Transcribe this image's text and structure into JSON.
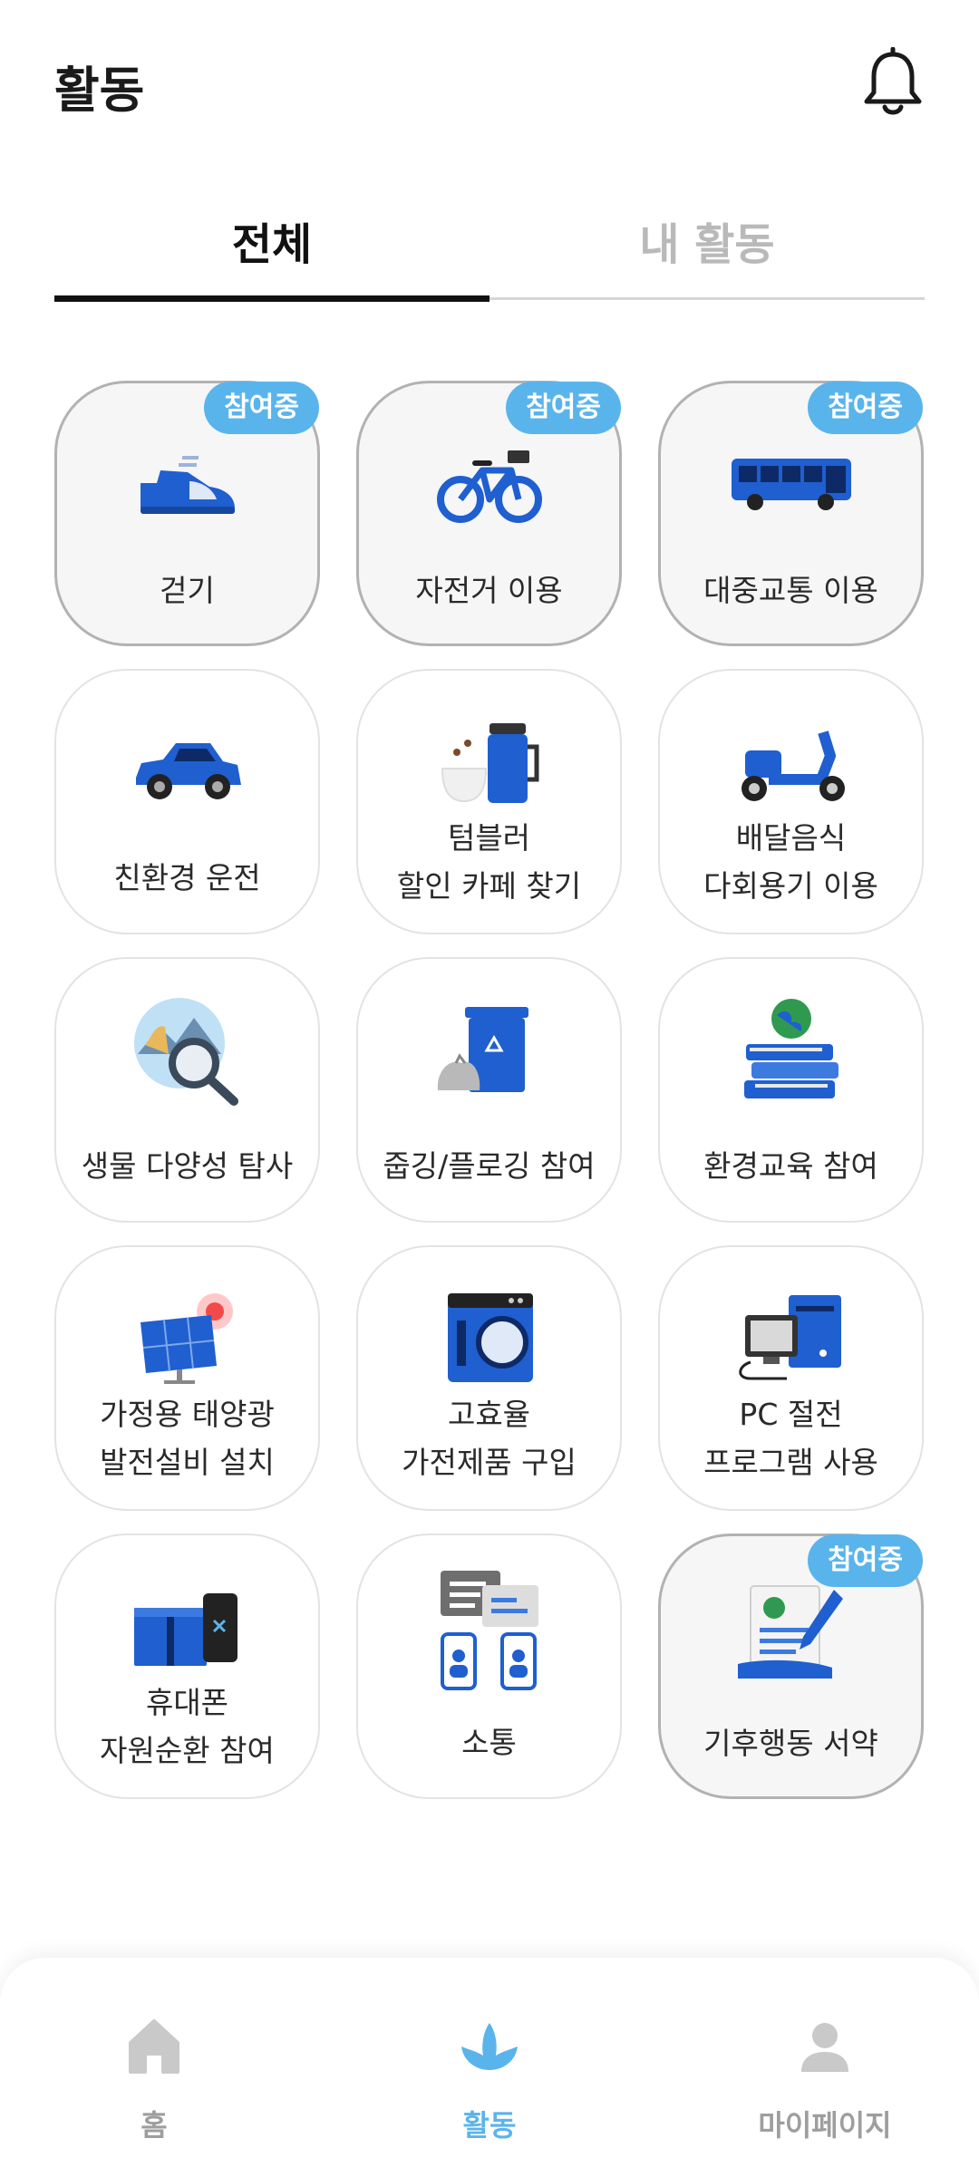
{
  "header": {
    "title": "활동",
    "notification_icon": "bell-icon"
  },
  "tabs": [
    {
      "label": "전체",
      "selected": true
    },
    {
      "label": "내 활동",
      "selected": false
    }
  ],
  "badge_text": "참여중",
  "activities": [
    {
      "line1": "걷기",
      "line2": "",
      "participating": true,
      "icon": "sneaker-icon"
    },
    {
      "line1": "자전거 이용",
      "line2": "",
      "participating": true,
      "icon": "bicycle-icon"
    },
    {
      "line1": "대중교통 이용",
      "line2": "",
      "participating": true,
      "icon": "bus-icon"
    },
    {
      "line1": "친환경 운전",
      "line2": "",
      "participating": false,
      "icon": "car-icon"
    },
    {
      "line1": "텀블러",
      "line2": "할인 카페 찾기",
      "participating": false,
      "icon": "tumbler-icon"
    },
    {
      "line1": "배달음식",
      "line2": "다회용기 이용",
      "participating": false,
      "icon": "scooter-icon"
    },
    {
      "line1": "생물 다양성 탐사",
      "line2": "",
      "participating": false,
      "icon": "magnifier-globe-icon"
    },
    {
      "line1": "줍깅/플로깅 참여",
      "line2": "",
      "participating": false,
      "icon": "recycle-bin-icon"
    },
    {
      "line1": "환경교육 참여",
      "line2": "",
      "participating": false,
      "icon": "books-globe-icon"
    },
    {
      "line1": "가정용 태양광",
      "line2": "발전설비 설치",
      "participating": false,
      "icon": "solar-panel-icon"
    },
    {
      "line1": "고효율",
      "line2": "가전제품 구입",
      "participating": false,
      "icon": "washing-machine-icon"
    },
    {
      "line1": "PC 절전",
      "line2": "프로그램 사용",
      "participating": false,
      "icon": "computer-icon"
    },
    {
      "line1": "휴대폰",
      "line2": "자원순환 참여",
      "participating": false,
      "icon": "phone-box-icon"
    },
    {
      "line1": "소통",
      "line2": "",
      "participating": false,
      "icon": "chat-people-icon"
    },
    {
      "line1": "기후행동 서약",
      "line2": "",
      "participating": true,
      "icon": "pledge-document-icon"
    }
  ],
  "bottom_nav": [
    {
      "label": "홈",
      "icon": "home-icon",
      "selected": false
    },
    {
      "label": "활동",
      "icon": "leaf-hand-icon",
      "selected": true
    },
    {
      "label": "마이페이지",
      "icon": "person-icon",
      "selected": false
    }
  ],
  "colors": {
    "accent": "#5ab4ec",
    "icon_blue": "#1f5fd0",
    "inactive": "#9e9e9e"
  }
}
